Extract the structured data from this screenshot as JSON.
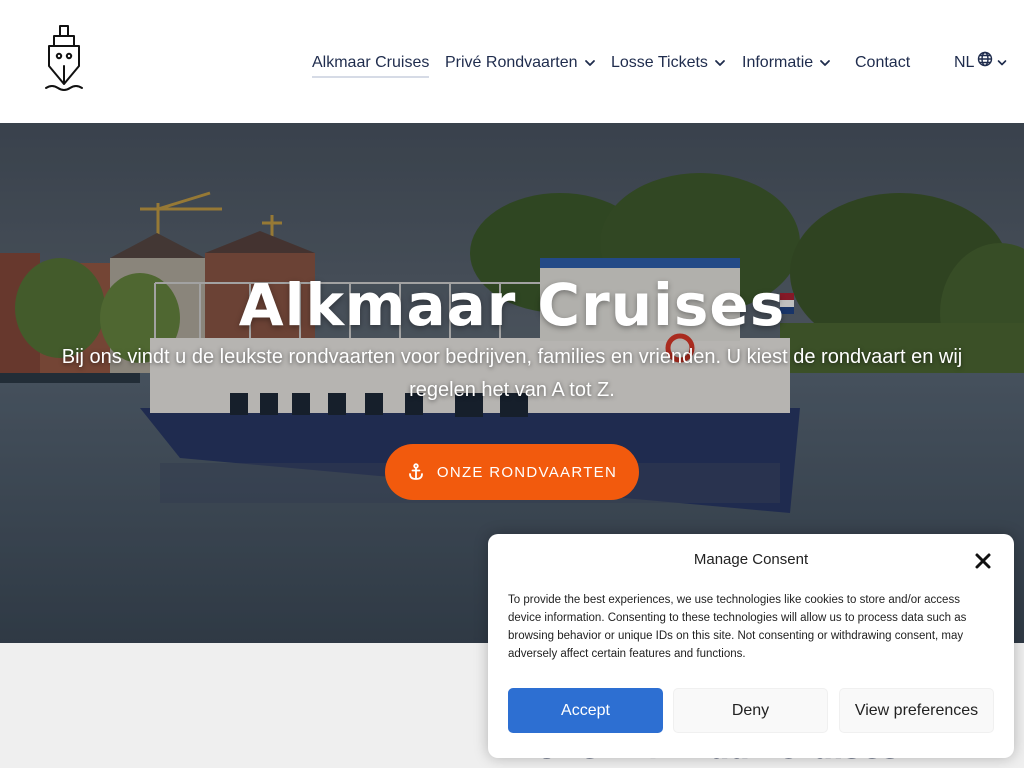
{
  "header": {
    "logo_icon": "ship-icon",
    "nav": [
      {
        "label": "Alkmaar Cruises",
        "active": true,
        "dropdown": false
      },
      {
        "label": "Privé Rondvaarten",
        "active": false,
        "dropdown": true
      },
      {
        "label": "Losse Tickets",
        "active": false,
        "dropdown": true
      },
      {
        "label": "Informatie",
        "active": false,
        "dropdown": true
      },
      {
        "label": "Contact",
        "active": false,
        "dropdown": false
      }
    ],
    "language": {
      "label": "NL",
      "icon": "globe-icon"
    }
  },
  "hero": {
    "title": "Alkmaar Cruises",
    "subtitle": "Bij ons vindt u de leukste rondvaarten voor bedrijven, families en vrienden. U kiest de rondvaart en wij regelen het van A tot Z.",
    "button_label": "ONZE RONDVAARTEN",
    "button_icon": "anchor-icon"
  },
  "section": {
    "heading": "Over Alkmaar Cruises"
  },
  "consent": {
    "title": "Manage Consent",
    "text": "To provide the best experiences, we use technologies like cookies to store and/or access device information. Consenting to these technologies will allow us to process data such as browsing behavior or unique IDs on this site. Not consenting or withdrawing consent, may adversely affect certain features and functions.",
    "accept_label": "Accept",
    "deny_label": "Deny",
    "preferences_label": "View preferences"
  },
  "colors": {
    "nav_text": "#1f2c4d",
    "cta_orange": "#f25a0d",
    "accept_blue": "#2d6fd2"
  }
}
